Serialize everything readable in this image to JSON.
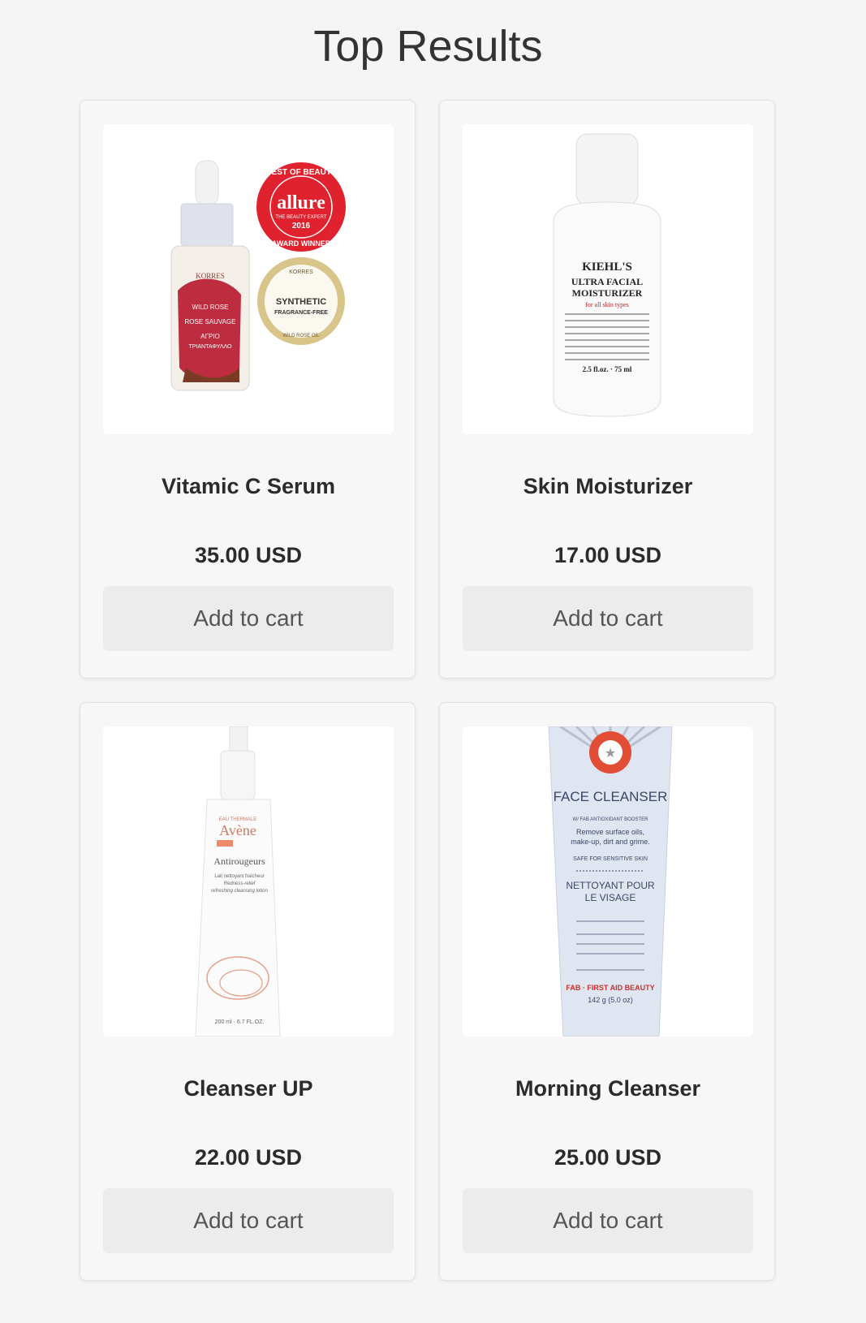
{
  "page": {
    "title": "Top Results"
  },
  "products": [
    {
      "name": "Vitamic C Serum",
      "price": "35.00 USD",
      "button_label": "Add to cart",
      "image": {
        "icon": "serum-bottle-image",
        "badge_top_ring": "BEST OF BEAUTY",
        "badge_brand": "allure",
        "badge_sub": "THE BEAUTY EXPERT",
        "badge_year": "2016",
        "badge_bottom_ring": "AWARD WINNER",
        "seal_top": "KORRES",
        "seal_line1": "SYNTHETIC",
        "seal_line2": "FRAGRANCE-FREE",
        "seal_bottom": "WILD ROSE OIL",
        "label_brand": "KORRES",
        "label_line1": "WILD ROSE",
        "label_line2": "ROSE SAUVAGE",
        "label_line3": "ΑΓΡΙΟ",
        "label_line4": "ΤΡΙΑΝΤΑΦΥΛΛΟ"
      }
    },
    {
      "name": "Skin Moisturizer",
      "price": "17.00 USD",
      "button_label": "Add to cart",
      "image": {
        "icon": "moisturizer-bottle-image",
        "label_brand": "KIEHL'S",
        "label_line1": "ULTRA FACIAL",
        "label_line2": "MOISTURIZER",
        "label_line3": "for all skin types",
        "label_size": "2.5 fl.oz. · 75 ml"
      }
    },
    {
      "name": "Cleanser UP",
      "price": "22.00 USD",
      "button_label": "Add to cart",
      "image": {
        "icon": "cleanser-pump-bottle-image",
        "label_top": "EAU THERMALE",
        "label_brand": "Avène",
        "label_line1": "Antirougeurs",
        "label_line2": "Lait nettoyant fraîcheur",
        "label_line3": "Redness-relief",
        "label_line4": "refreshing cleansing lotion",
        "label_size": "200 ml · 6.7 FL.OZ."
      }
    },
    {
      "name": "Morning Cleanser",
      "price": "25.00 USD",
      "button_label": "Add to cart",
      "image": {
        "icon": "cleanser-tube-image",
        "label_title": "FACE CLEANSER",
        "label_line1": "W/ FAB ANTIOXIDANT BOOSTER",
        "label_line2": "Remove surface oils,",
        "label_line3": "make-up, dirt and grime.",
        "label_line4": "SAFE FOR SENSITIVE SKIN",
        "label_line5": "NETTOYANT POUR",
        "label_line6": "LE VISAGE",
        "label_brand": "FAB · FIRST AID BEAUTY",
        "label_size": "142 g (5.0 oz)"
      }
    }
  ]
}
